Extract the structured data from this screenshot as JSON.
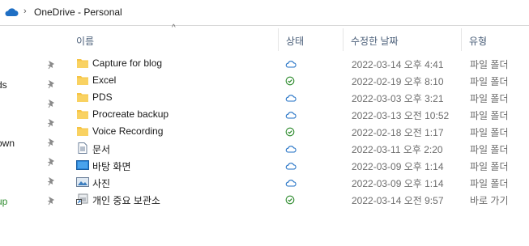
{
  "address": {
    "chevron": "›",
    "path": "OneDrive - Personal"
  },
  "nav": {
    "items": [
      {
        "label": "",
        "pinned": true
      },
      {
        "label": "ds",
        "pinned": true
      },
      {
        "label": "",
        "pinned": true
      },
      {
        "label": "",
        "pinned": true
      },
      {
        "label": "own",
        "pinned": true
      },
      {
        "label": "",
        "pinned": true
      },
      {
        "label": "",
        "pinned": true
      },
      {
        "label": "up",
        "pinned": true,
        "color": "#2e8b2e"
      }
    ]
  },
  "header": {
    "sort_indicator": "^",
    "columns": [
      "이름",
      "상태",
      "수정한 날짜",
      "유형"
    ]
  },
  "files": [
    {
      "name": "Capture for blog",
      "icon": "folder-icon",
      "status": "cloud",
      "date": "2022-03-14 오후 4:41",
      "type": "파일 폴더"
    },
    {
      "name": "Excel",
      "icon": "folder-icon",
      "status": "synced",
      "date": "2022-02-19 오후 8:10",
      "type": "파일 폴더"
    },
    {
      "name": "PDS",
      "icon": "folder-icon",
      "status": "cloud",
      "date": "2022-03-03 오후 3:21",
      "type": "파일 폴더"
    },
    {
      "name": "Procreate backup",
      "icon": "folder-icon",
      "status": "cloud",
      "date": "2022-03-13 오전 10:52",
      "type": "파일 폴더"
    },
    {
      "name": "Voice Recording",
      "icon": "folder-icon",
      "status": "synced",
      "date": "2022-02-18 오전 1:17",
      "type": "파일 폴더"
    },
    {
      "name": "문서",
      "icon": "documents-icon",
      "status": "cloud",
      "date": "2022-03-11 오후 2:20",
      "type": "파일 폴더"
    },
    {
      "name": "바탕 화면",
      "icon": "desktop-icon",
      "status": "cloud",
      "date": "2022-03-09 오후 1:14",
      "type": "파일 폴더"
    },
    {
      "name": "사진",
      "icon": "pictures-icon",
      "status": "cloud",
      "date": "2022-03-09 오후 1:14",
      "type": "파일 폴더"
    },
    {
      "name": "개인 중요 보관소",
      "icon": "vault-shortcut-icon",
      "status": "synced",
      "date": "2022-03-14 오전 9:57",
      "type": "바로 가기"
    }
  ],
  "colors": {
    "folder": "#f6c445",
    "cloud": "#1f6fc4",
    "synced": "#2e8b2e",
    "header_text": "#4c607a"
  }
}
